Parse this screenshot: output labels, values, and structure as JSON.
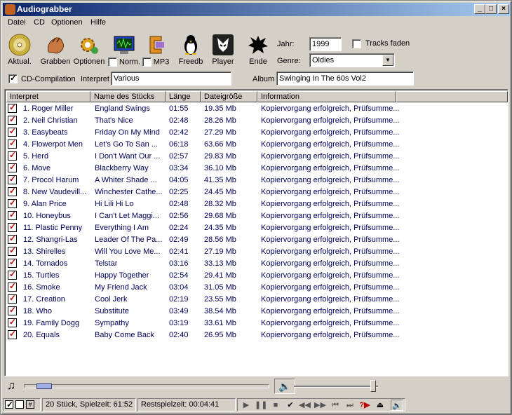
{
  "window": {
    "title": "Audiograbber"
  },
  "menu": [
    "Datei",
    "CD",
    "Optionen",
    "Hilfe"
  ],
  "toolbar": {
    "buttons": [
      {
        "label": "Aktual.",
        "icon": "cd-disc-icon"
      },
      {
        "label": "Grabben",
        "icon": "grab-hand-icon"
      },
      {
        "label": "Optionen",
        "icon": "gear-icon"
      },
      {
        "label": "Norm.",
        "icon": "monitor-waveform-icon",
        "checkbox": true
      },
      {
        "label": "MP3",
        "icon": "mp3-clamp-icon",
        "checkbox": true
      },
      {
        "label": "Freedb",
        "icon": "penguin-icon"
      },
      {
        "label": "Player",
        "icon": "player-logo-icon"
      },
      {
        "label": "Ende",
        "icon": "exit-splat-icon"
      }
    ]
  },
  "meta": {
    "year_label": "Jahr:",
    "year": "1999",
    "fade_label": "Tracks faden",
    "genre_label": "Genre:",
    "genre": "Oldies",
    "compilation_label": "CD-Compilation",
    "artist_label": "Interpret",
    "artist": "Various",
    "album_label": "Album",
    "album": "Swinging In The 60s Vol2"
  },
  "columns": [
    "Interpret",
    "Name des Stücks",
    "Länge",
    "Dateigröße",
    "Information"
  ],
  "tracks": [
    [
      "1. Roger Miller",
      "England Swings",
      "01:55",
      "19.35 Mb",
      "Kopiervorgang erfolgreich, Prüfsumme..."
    ],
    [
      "2. Neil Christian",
      "That's Nice",
      "02:48",
      "28.26 Mb",
      "Kopiervorgang erfolgreich, Prüfsumme..."
    ],
    [
      "3. Easybeats",
      "Friday On My Mind",
      "02:42",
      "27.29 Mb",
      "Kopiervorgang erfolgreich, Prüfsumme..."
    ],
    [
      "4. Flowerpot Men",
      "Let's Go To San ...",
      "06:18",
      "63.66 Mb",
      "Kopiervorgang erfolgreich, Prüfsumme..."
    ],
    [
      "5. Herd",
      "I Don't Want Our ...",
      "02:57",
      "29.83 Mb",
      "Kopiervorgang erfolgreich, Prüfsumme..."
    ],
    [
      "6. Move",
      "Blackberry Way",
      "03:34",
      "36.10 Mb",
      "Kopiervorgang erfolgreich, Prüfsumme..."
    ],
    [
      "7. Procol Harum",
      "A Whiter Shade ...",
      "04:05",
      "41.35 Mb",
      "Kopiervorgang erfolgreich, Prüfsumme..."
    ],
    [
      "8. New Vaudevill...",
      "Winchester Cathe...",
      "02:25",
      "24.45 Mb",
      "Kopiervorgang erfolgreich, Prüfsumme..."
    ],
    [
      "9. Alan Price",
      "Hi Lili Hi Lo",
      "02:48",
      "28.32 Mb",
      "Kopiervorgang erfolgreich, Prüfsumme..."
    ],
    [
      "10. Honeybus",
      "I Can't Let Maggi...",
      "02:56",
      "29.68 Mb",
      "Kopiervorgang erfolgreich, Prüfsumme..."
    ],
    [
      "11. Plastic Penny",
      "Everything I Am",
      "02:24",
      "24.35 Mb",
      "Kopiervorgang erfolgreich, Prüfsumme..."
    ],
    [
      "12. Shangri-Las",
      "Leader Of The Pa...",
      "02:49",
      "28.56 Mb",
      "Kopiervorgang erfolgreich, Prüfsumme..."
    ],
    [
      "13. Shirelles",
      "Will You Love Me...",
      "02:41",
      "27.19 Mb",
      "Kopiervorgang erfolgreich, Prüfsumme..."
    ],
    [
      "14. Tornados",
      "Telstar",
      "03:16",
      "33.13 Mb",
      "Kopiervorgang erfolgreich, Prüfsumme..."
    ],
    [
      "15. Turtles",
      "Happy Together",
      "02:54",
      "29.41 Mb",
      "Kopiervorgang erfolgreich, Prüfsumme..."
    ],
    [
      "16. Smoke",
      "My Friend Jack",
      "03:04",
      "31.05 Mb",
      "Kopiervorgang erfolgreich, Prüfsumme..."
    ],
    [
      "17. Creation",
      "Cool Jerk",
      "02:19",
      "23.55 Mb",
      "Kopiervorgang erfolgreich, Prüfsumme..."
    ],
    [
      "18. Who",
      "Substitute",
      "03:49",
      "38.54 Mb",
      "Kopiervorgang erfolgreich, Prüfsumme..."
    ],
    [
      "19. Family Dogg",
      "Sympathy",
      "03:19",
      "33.61 Mb",
      "Kopiervorgang erfolgreich, Prüfsumme..."
    ],
    [
      "20. Equals",
      "Baby Come Back",
      "02:40",
      "26.95 Mb",
      "Kopiervorgang erfolgreich, Prüfsumme..."
    ]
  ],
  "status": {
    "tracks_count": "20 Stück,",
    "playtime": "Spielzeit: 61:52",
    "remaining": "Restspielzeit: 00:04:41"
  },
  "volume_level": 0.97,
  "position_level": 0.05,
  "colors": {
    "accent": "#0a246a",
    "track_text": "#00005a",
    "check": "#c00000"
  }
}
